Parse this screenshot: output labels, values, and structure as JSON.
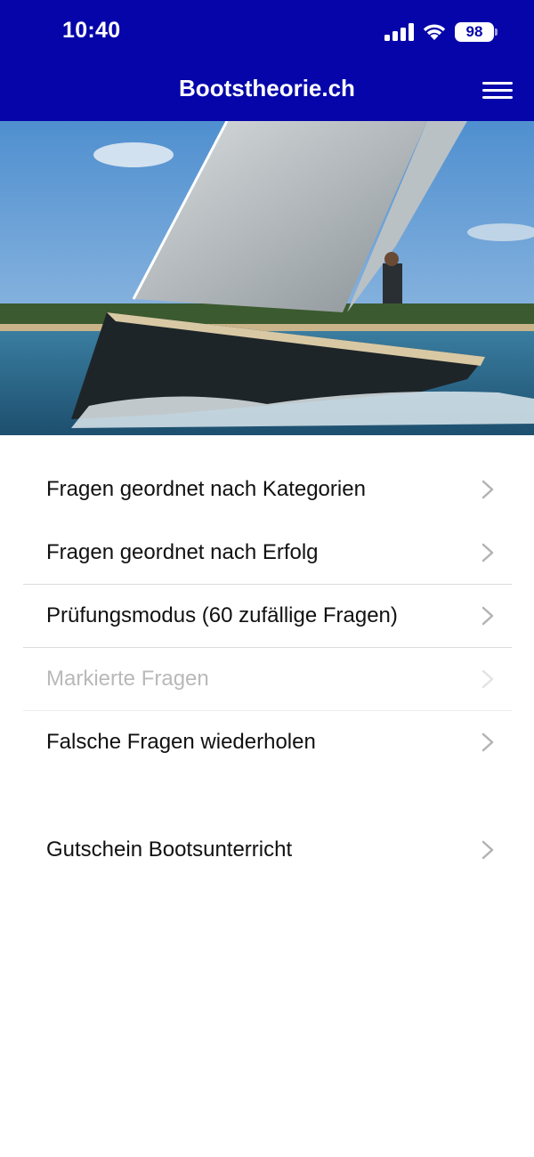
{
  "status_bar": {
    "time": "10:40",
    "battery": "98",
    "icons": [
      "signal-icon",
      "wifi-icon",
      "battery-icon"
    ]
  },
  "header": {
    "title": "Bootstheorie.ch",
    "menu_icon": "hamburger-menu-icon",
    "background_color": "#0505AA"
  },
  "hero": {
    "description_icon": "sailboat-photo"
  },
  "menu": {
    "group1": [
      {
        "label": "Fragen geordnet nach Kategorien",
        "enabled": true
      },
      {
        "label": "Fragen geordnet nach Erfolg",
        "enabled": true
      },
      {
        "label": "Prüfungsmodus (60 zufällige Fragen)",
        "enabled": true
      },
      {
        "label": "Markierte Fragen",
        "enabled": false
      },
      {
        "label": "Falsche Fragen wiederholen",
        "enabled": true
      }
    ],
    "group2": [
      {
        "label": "Gutschein Bootsunterricht",
        "enabled": true
      }
    ],
    "chevron_icon": "chevron-right-icon"
  }
}
